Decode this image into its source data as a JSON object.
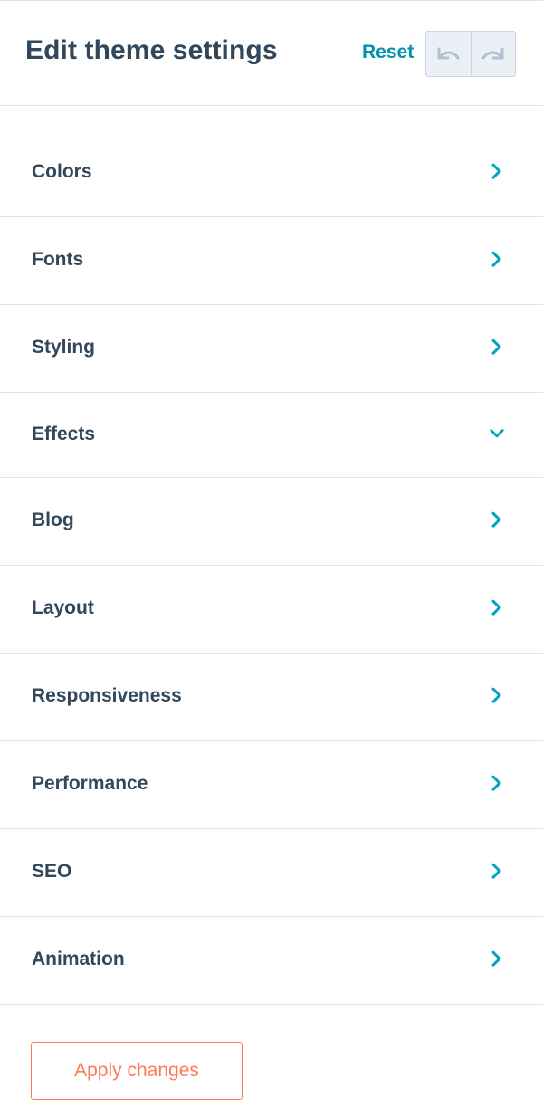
{
  "header": {
    "title": "Edit theme settings",
    "reset_label": "Reset",
    "undo_icon": "undo-icon",
    "redo_icon": "redo-icon"
  },
  "sections": [
    {
      "label": "Colors",
      "icon": "chevron-right-icon",
      "expanded": false
    },
    {
      "label": "Fonts",
      "icon": "chevron-right-icon",
      "expanded": false
    },
    {
      "label": "Styling",
      "icon": "chevron-right-icon",
      "expanded": false
    },
    {
      "label": "Effects",
      "icon": "chevron-down-icon",
      "expanded": true
    },
    {
      "label": "Blog",
      "icon": "chevron-right-icon",
      "expanded": false
    },
    {
      "label": "Layout",
      "icon": "chevron-right-icon",
      "expanded": false
    },
    {
      "label": "Responsiveness",
      "icon": "chevron-right-icon",
      "expanded": false
    },
    {
      "label": "Performance",
      "icon": "chevron-right-icon",
      "expanded": false
    },
    {
      "label": "SEO",
      "icon": "chevron-right-icon",
      "expanded": false
    },
    {
      "label": "Animation",
      "icon": "chevron-right-icon",
      "expanded": false
    }
  ],
  "footer": {
    "apply_label": "Apply changes"
  },
  "colors": {
    "text": "#33475b",
    "accent": "#0091ae",
    "chevron": "#00a4bd",
    "apply": "#ff7a59",
    "divider": "#dfe3eb",
    "history_bg": "#eaf0f6",
    "history_icon": "#b0c1d4"
  }
}
